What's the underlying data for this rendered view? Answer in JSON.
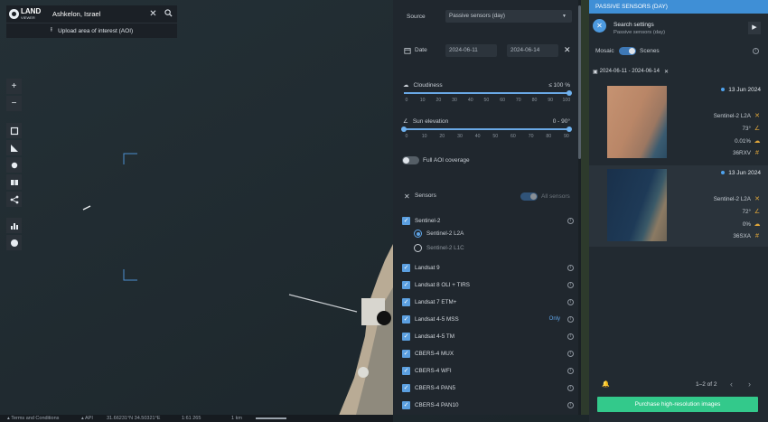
{
  "search": {
    "logo_text": "LAND",
    "logo_sub": "VIEWER",
    "query": "Ashkelon, Israel",
    "upload_label": "Upload area of interest (AOI)"
  },
  "map_tools": {
    "zoom_in": "+",
    "zoom_out": "−"
  },
  "status_bar": {
    "terms": "Terms and Conditions",
    "api": "API",
    "coords": "31.66231°N 34.50321°E",
    "scale_ratio": "1:61 265",
    "scale_dist": "1 km"
  },
  "filters": {
    "source_label": "Source",
    "source_value": "Passive sensors (day)",
    "date_label": "Date",
    "date_from": "2024-06-11",
    "date_to": "2024-06-14",
    "cloudiness_label": "Cloudiness",
    "cloudiness_value": "≤ 100 %",
    "cloud_ticks": [
      "0",
      "10",
      "20",
      "30",
      "40",
      "50",
      "60",
      "70",
      "80",
      "90",
      "100"
    ],
    "cloudiness_max": 100,
    "sun_label": "Sun elevation",
    "sun_value": "0 - 90°",
    "sun_ticks": [
      "0",
      "10",
      "20",
      "30",
      "40",
      "50",
      "60",
      "70",
      "80",
      "90"
    ],
    "sun_range": [
      0,
      90
    ],
    "full_aoi_label": "Full AOI coverage",
    "full_aoi_on": false,
    "sensors_label": "Sensors",
    "all_sensors_label": "All sensors",
    "sentinel_group": "Sentinel-2",
    "radio_l2a": "Sentinel-2 L2A",
    "radio_l1c": "Sentinel-2 L1C",
    "sensors": [
      "Landsat 9",
      "Landsat 8 OLI + TIRS",
      "Landsat 7 ETM+",
      "Landsat 4-5 MSS",
      "Landsat 4-5 TM",
      "CBERS-4 MUX",
      "CBERS-4 WFI",
      "CBERS-4 PAN5",
      "CBERS-4 PAN10"
    ],
    "only_label": "Only"
  },
  "results": {
    "header": "PASSIVE SENSORS (DAY)",
    "search_title": "Search settings",
    "search_sub": "Passive sensors (day)",
    "mosaic_label": "Mosaic",
    "scenes_label": "Scenes",
    "date_chip": "2024-06-11 - 2024-06-14",
    "items": [
      {
        "date": "13 Jun 2024",
        "sensor": "Sentinel-2  L2A",
        "sun": "73°",
        "cloud": "0.01%",
        "tile": "36RXV"
      },
      {
        "date": "13 Jun 2024",
        "sensor": "Sentinel-2  L2A",
        "sun": "72°",
        "cloud": "0%",
        "tile": "36SXA"
      }
    ],
    "pager": "1–2 of 2",
    "buy_label": "Purchase high-resolution images"
  },
  "colors": {
    "accent": "#3f8fd6",
    "buy": "#33c98b",
    "panel": "#20272e"
  }
}
